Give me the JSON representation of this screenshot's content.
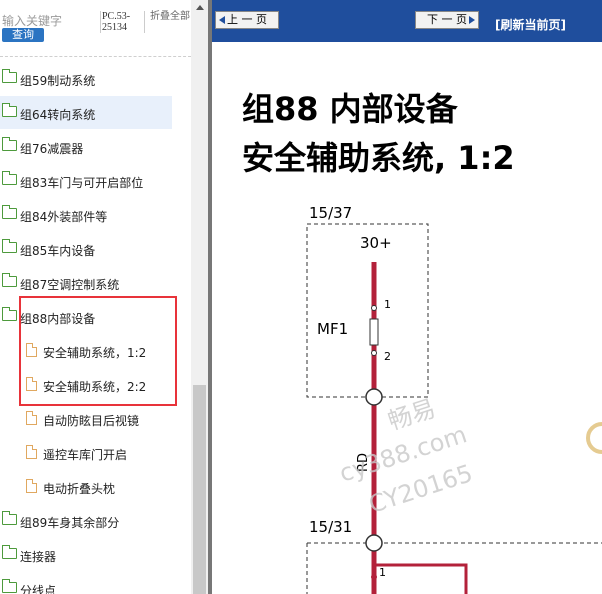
{
  "search": {
    "keyword_label": "输入关键字",
    "query_button": "查询",
    "pc_code": "PC.53-25134",
    "fold_all": "折叠全部"
  },
  "tree": {
    "items": [
      {
        "label": "组59制动系统",
        "type": "folder"
      },
      {
        "label": "组64转向系统",
        "type": "folder"
      },
      {
        "label": "组76减震器",
        "type": "folder"
      },
      {
        "label": "组83车门与可开启部位",
        "type": "folder"
      },
      {
        "label": "组84外装部件等",
        "type": "folder"
      },
      {
        "label": "组85车内设备",
        "type": "folder"
      },
      {
        "label": "组87空调控制系统",
        "type": "folder"
      },
      {
        "label": "组88内部设备",
        "type": "folder"
      },
      {
        "label": "安全辅助系统，1:2",
        "type": "doc"
      },
      {
        "label": "安全辅助系统，2:2",
        "type": "doc"
      },
      {
        "label": "自动防眩目后视镜",
        "type": "doc"
      },
      {
        "label": "遥控车库门开启",
        "type": "doc"
      },
      {
        "label": "电动折叠头枕",
        "type": "doc"
      },
      {
        "label": "组89车身其余部分",
        "type": "folder"
      },
      {
        "label": "连接器",
        "type": "folder"
      },
      {
        "label": "分线点",
        "type": "folder"
      }
    ]
  },
  "nav": {
    "prev_label": "上 一 页",
    "next_label": "下 一 页",
    "refresh_label": "[刷新当前页]"
  },
  "doc": {
    "title_line1": "组88 内部设备",
    "title_line2": "安全辅助系统, 1:2",
    "ref_top": "15/37",
    "power_label": "30+",
    "fuse_label": "MF1",
    "pin1": "1",
    "pin2": "2",
    "wire_color": "RD",
    "ref_bottom": "15/31",
    "pin_bottom": "1"
  },
  "watermark": {
    "line1": "畅易",
    "line2": "cy388.com",
    "line3": "CY20165"
  },
  "colors": {
    "header": "#1f4e9d",
    "wire": "#b3213a",
    "highlight_box": "#e8333a"
  }
}
